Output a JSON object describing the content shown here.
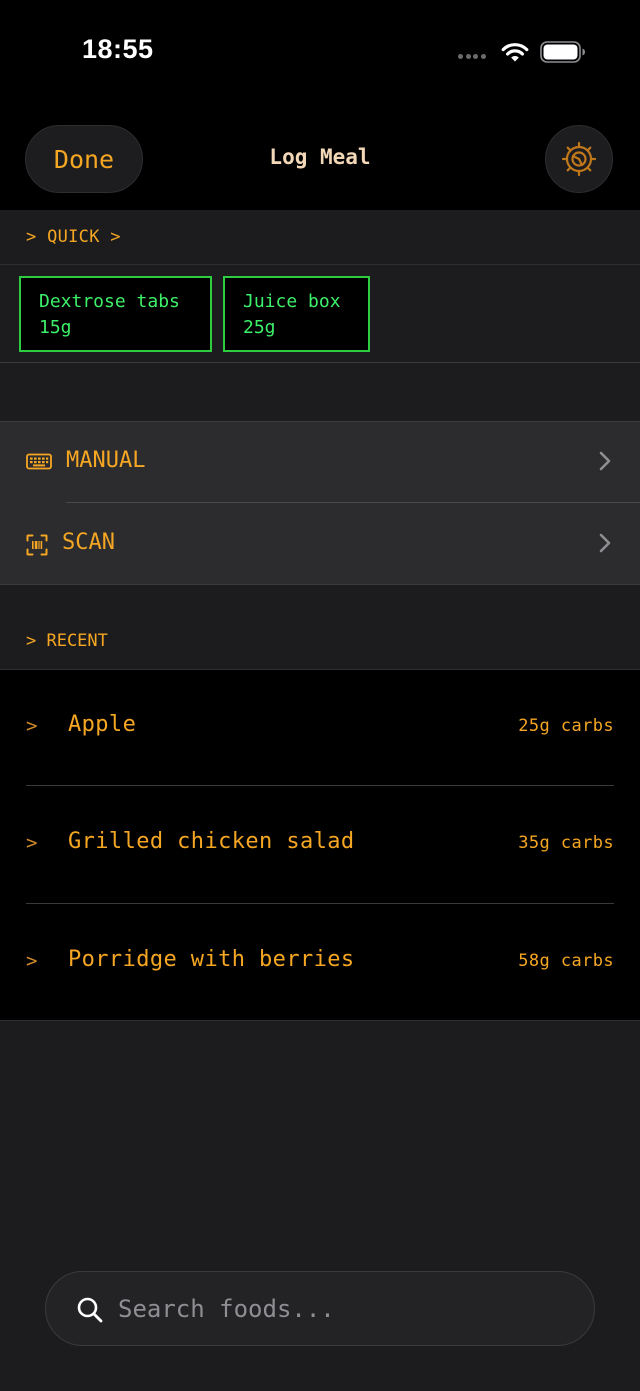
{
  "status_bar": {
    "time": "18:55"
  },
  "nav": {
    "done_label": "Done",
    "title": "Log Meal",
    "settings_icon": "gear-icon"
  },
  "quick": {
    "header": "> QUICK >",
    "items": [
      {
        "name": "Dextrose tabs",
        "amount": "15g"
      },
      {
        "name": "Juice box",
        "amount": "25g"
      }
    ]
  },
  "options": [
    {
      "label": "MANUAL",
      "icon": "keyboard-icon"
    },
    {
      "label": "SCAN",
      "icon": "barcode-scan-icon"
    }
  ],
  "recent": {
    "header": "> RECENT",
    "items": [
      {
        "arrow": ">",
        "name": "Apple",
        "carbs": "25g carbs"
      },
      {
        "arrow": ">",
        "name": "Grilled chicken salad",
        "carbs": "35g carbs"
      },
      {
        "arrow": ">",
        "name": "Porridge with berries",
        "carbs": "58g carbs"
      }
    ]
  },
  "search": {
    "placeholder": "Search foods...",
    "value": ""
  },
  "colors": {
    "accent": "#f5a623",
    "quick_chip": "#2ecc40",
    "background": "#1c1c1e"
  }
}
